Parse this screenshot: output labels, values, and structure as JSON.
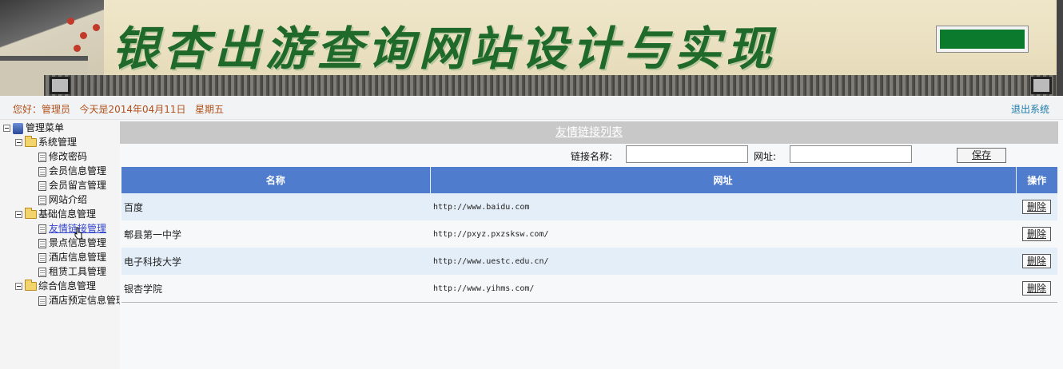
{
  "header": {
    "title": "银杏出游查询网站设计与实现"
  },
  "status": {
    "greeting": "您好：管理员   今天是2014年04月11日   星期五",
    "logout_label": "退出系统"
  },
  "sidebar": {
    "root": "管理菜单",
    "groups": [
      {
        "label": "系统管理",
        "items": [
          "修改密码",
          "会员信息管理",
          "会员留言管理",
          "网站介绍"
        ]
      },
      {
        "label": "基础信息管理",
        "items": [
          "友情链接管理",
          "景点信息管理",
          "酒店信息管理",
          "租赁工具管理"
        ]
      },
      {
        "label": "综合信息管理",
        "items": [
          "酒店预定信息管理"
        ]
      }
    ]
  },
  "main": {
    "caption": "友情链接列表",
    "form": {
      "name_label": "链接名称:",
      "name_value": "",
      "url_label": "网址:",
      "url_value": "",
      "save_label": "保存"
    },
    "table": {
      "headers": [
        "名称",
        "网址",
        "操作"
      ],
      "rows": [
        {
          "name": "百度",
          "url": "http://www.baidu.com",
          "action": "删除"
        },
        {
          "name": "郫县第一中学",
          "url": "http://pxyz.pxzsksw.com/",
          "action": "删除"
        },
        {
          "name": "电子科技大学",
          "url": "http://www.uestc.edu.cn/",
          "action": "删除"
        },
        {
          "name": "银杏学院",
          "url": "http://www.yihms.com/",
          "action": "删除"
        }
      ]
    }
  },
  "colors": {
    "table_header": "#4f7ccd",
    "title_green": "#1f6a2a",
    "greeting": "#b0501a",
    "logout": "#1b7aa8"
  }
}
